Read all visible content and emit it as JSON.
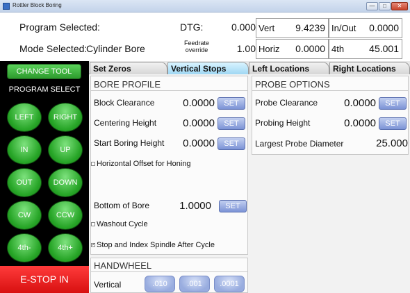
{
  "window": {
    "title": "Rottler Block Boring",
    "icons": [
      "app-icon",
      "minimize-icon",
      "maximize-icon",
      "close-icon"
    ]
  },
  "header": {
    "program_label": "Program Selected:",
    "mode_label": "Mode Selected:",
    "mode_value": "Cylinder Bore",
    "dtg_label": "DTG:",
    "dtg_value": "0.000",
    "feedrate_label": "Feedrate override",
    "feedrate_value": "1.00",
    "vert_label": "Vert",
    "vert_value": "9.4239",
    "inout_label": "In/Out",
    "inout_value": "0.0000",
    "horiz_label": "Horiz",
    "horiz_value": "0.0000",
    "fourth_label": "4th",
    "fourth_value": "45.001"
  },
  "left_panel": {
    "change_tool": "CHANGE TOOL",
    "program_select": "PROGRAM SELECT",
    "jog_buttons": [
      "LEFT",
      "RIGHT",
      "IN",
      "UP",
      "OUT",
      "DOWN",
      "CW",
      "CCW",
      "4th-",
      "4th+"
    ],
    "estop": "E-STOP IN",
    "colors": {
      "jog_green": "#2db02d",
      "estop_red": "#e31414"
    }
  },
  "tabs": [
    "Set Zeros",
    "Vertical Stops",
    "Left Locations",
    "Right Locations"
  ],
  "active_tab": "Vertical Stops",
  "bore_profile": {
    "title": "BORE PROFILE",
    "fields": [
      {
        "label": "Block Clearance",
        "value": "0.0000",
        "button": "SET"
      },
      {
        "label": "Centering Height",
        "value": "0.0000",
        "button": "SET"
      },
      {
        "label": "Start Boring Height",
        "value": "0.0000",
        "button": "SET"
      }
    ],
    "horizontal_offset": "Horizontal Offset for Honing",
    "bottom_of_bore": {
      "label": "Bottom of Bore",
      "value": "1.0000",
      "button": "SET"
    },
    "washout": "Washout Cycle",
    "stop_index": "Stop and Index Spindle After Cycle"
  },
  "probe_options": {
    "title": "PROBE OPTIONS",
    "fields": [
      {
        "label": "Probe Clearance",
        "value": "0.0000",
        "button": "SET"
      },
      {
        "label": "Probing Height",
        "value": "0.0000",
        "button": "SET"
      }
    ],
    "largest_label": "Largest Probe Diameter",
    "largest_value": "25.000"
  },
  "handwheel": {
    "title": "HANDWHEEL",
    "axis_label": "Vertical",
    "increments": [
      ".010",
      ".001",
      ".0001"
    ]
  }
}
